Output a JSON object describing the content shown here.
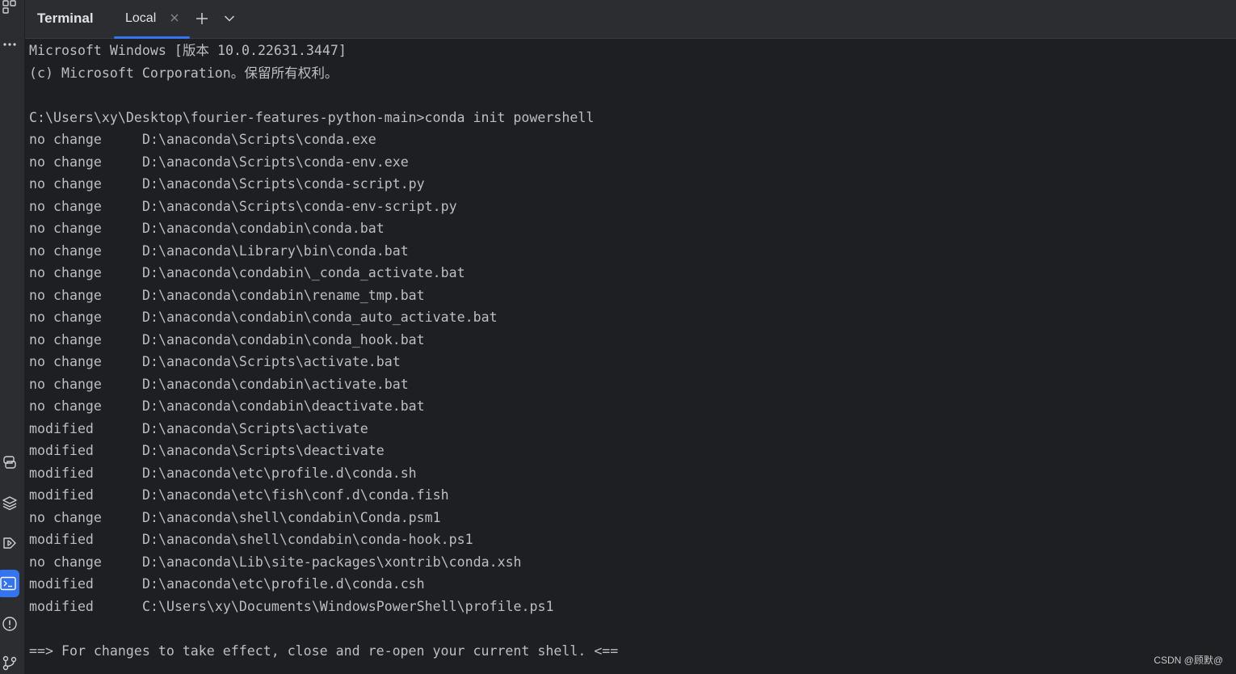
{
  "header": {
    "title": "Terminal",
    "tab_label": "Local"
  },
  "terminal": {
    "banner": [
      "Microsoft Windows [版本 10.0.22631.3447]",
      "(c) Microsoft Corporation。保留所有权利。"
    ],
    "command": "C:\\Users\\xy\\Desktop\\fourier-features-python-main>conda init powershell",
    "results": [
      {
        "status": "no change",
        "path": "D:\\anaconda\\Scripts\\conda.exe"
      },
      {
        "status": "no change",
        "path": "D:\\anaconda\\Scripts\\conda-env.exe"
      },
      {
        "status": "no change",
        "path": "D:\\anaconda\\Scripts\\conda-script.py"
      },
      {
        "status": "no change",
        "path": "D:\\anaconda\\Scripts\\conda-env-script.py"
      },
      {
        "status": "no change",
        "path": "D:\\anaconda\\condabin\\conda.bat"
      },
      {
        "status": "no change",
        "path": "D:\\anaconda\\Library\\bin\\conda.bat"
      },
      {
        "status": "no change",
        "path": "D:\\anaconda\\condabin\\_conda_activate.bat"
      },
      {
        "status": "no change",
        "path": "D:\\anaconda\\condabin\\rename_tmp.bat"
      },
      {
        "status": "no change",
        "path": "D:\\anaconda\\condabin\\conda_auto_activate.bat"
      },
      {
        "status": "no change",
        "path": "D:\\anaconda\\condabin\\conda_hook.bat"
      },
      {
        "status": "no change",
        "path": "D:\\anaconda\\Scripts\\activate.bat"
      },
      {
        "status": "no change",
        "path": "D:\\anaconda\\condabin\\activate.bat"
      },
      {
        "status": "no change",
        "path": "D:\\anaconda\\condabin\\deactivate.bat"
      },
      {
        "status": "modified",
        "path": "D:\\anaconda\\Scripts\\activate"
      },
      {
        "status": "modified",
        "path": "D:\\anaconda\\Scripts\\deactivate"
      },
      {
        "status": "modified",
        "path": "D:\\anaconda\\etc\\profile.d\\conda.sh"
      },
      {
        "status": "modified",
        "path": "D:\\anaconda\\etc\\fish\\conf.d\\conda.fish"
      },
      {
        "status": "no change",
        "path": "D:\\anaconda\\shell\\condabin\\Conda.psm1"
      },
      {
        "status": "modified",
        "path": "D:\\anaconda\\shell\\condabin\\conda-hook.ps1"
      },
      {
        "status": "no change",
        "path": "D:\\anaconda\\Lib\\site-packages\\xontrib\\conda.xsh"
      },
      {
        "status": "modified",
        "path": "D:\\anaconda\\etc\\profile.d\\conda.csh"
      },
      {
        "status": "modified",
        "path": "C:\\Users\\xy\\Documents\\WindowsPowerShell\\profile.ps1"
      }
    ],
    "footer": "==> For changes to take effect, close and re-open your current shell. <=="
  },
  "watermark": "CSDN @顾默@",
  "icons": {
    "sidebar": [
      "project-icon",
      "more-icon",
      "python-console-icon",
      "layers-icon",
      "run-icon",
      "terminal-icon",
      "problems-icon",
      "git-icon"
    ],
    "header": [
      "close-icon",
      "plus-icon",
      "chevron-down-icon"
    ]
  },
  "colors": {
    "background": "#1e1f22",
    "panel": "#2b2d30",
    "text": "#bcbec4",
    "accent": "#3574f0"
  }
}
